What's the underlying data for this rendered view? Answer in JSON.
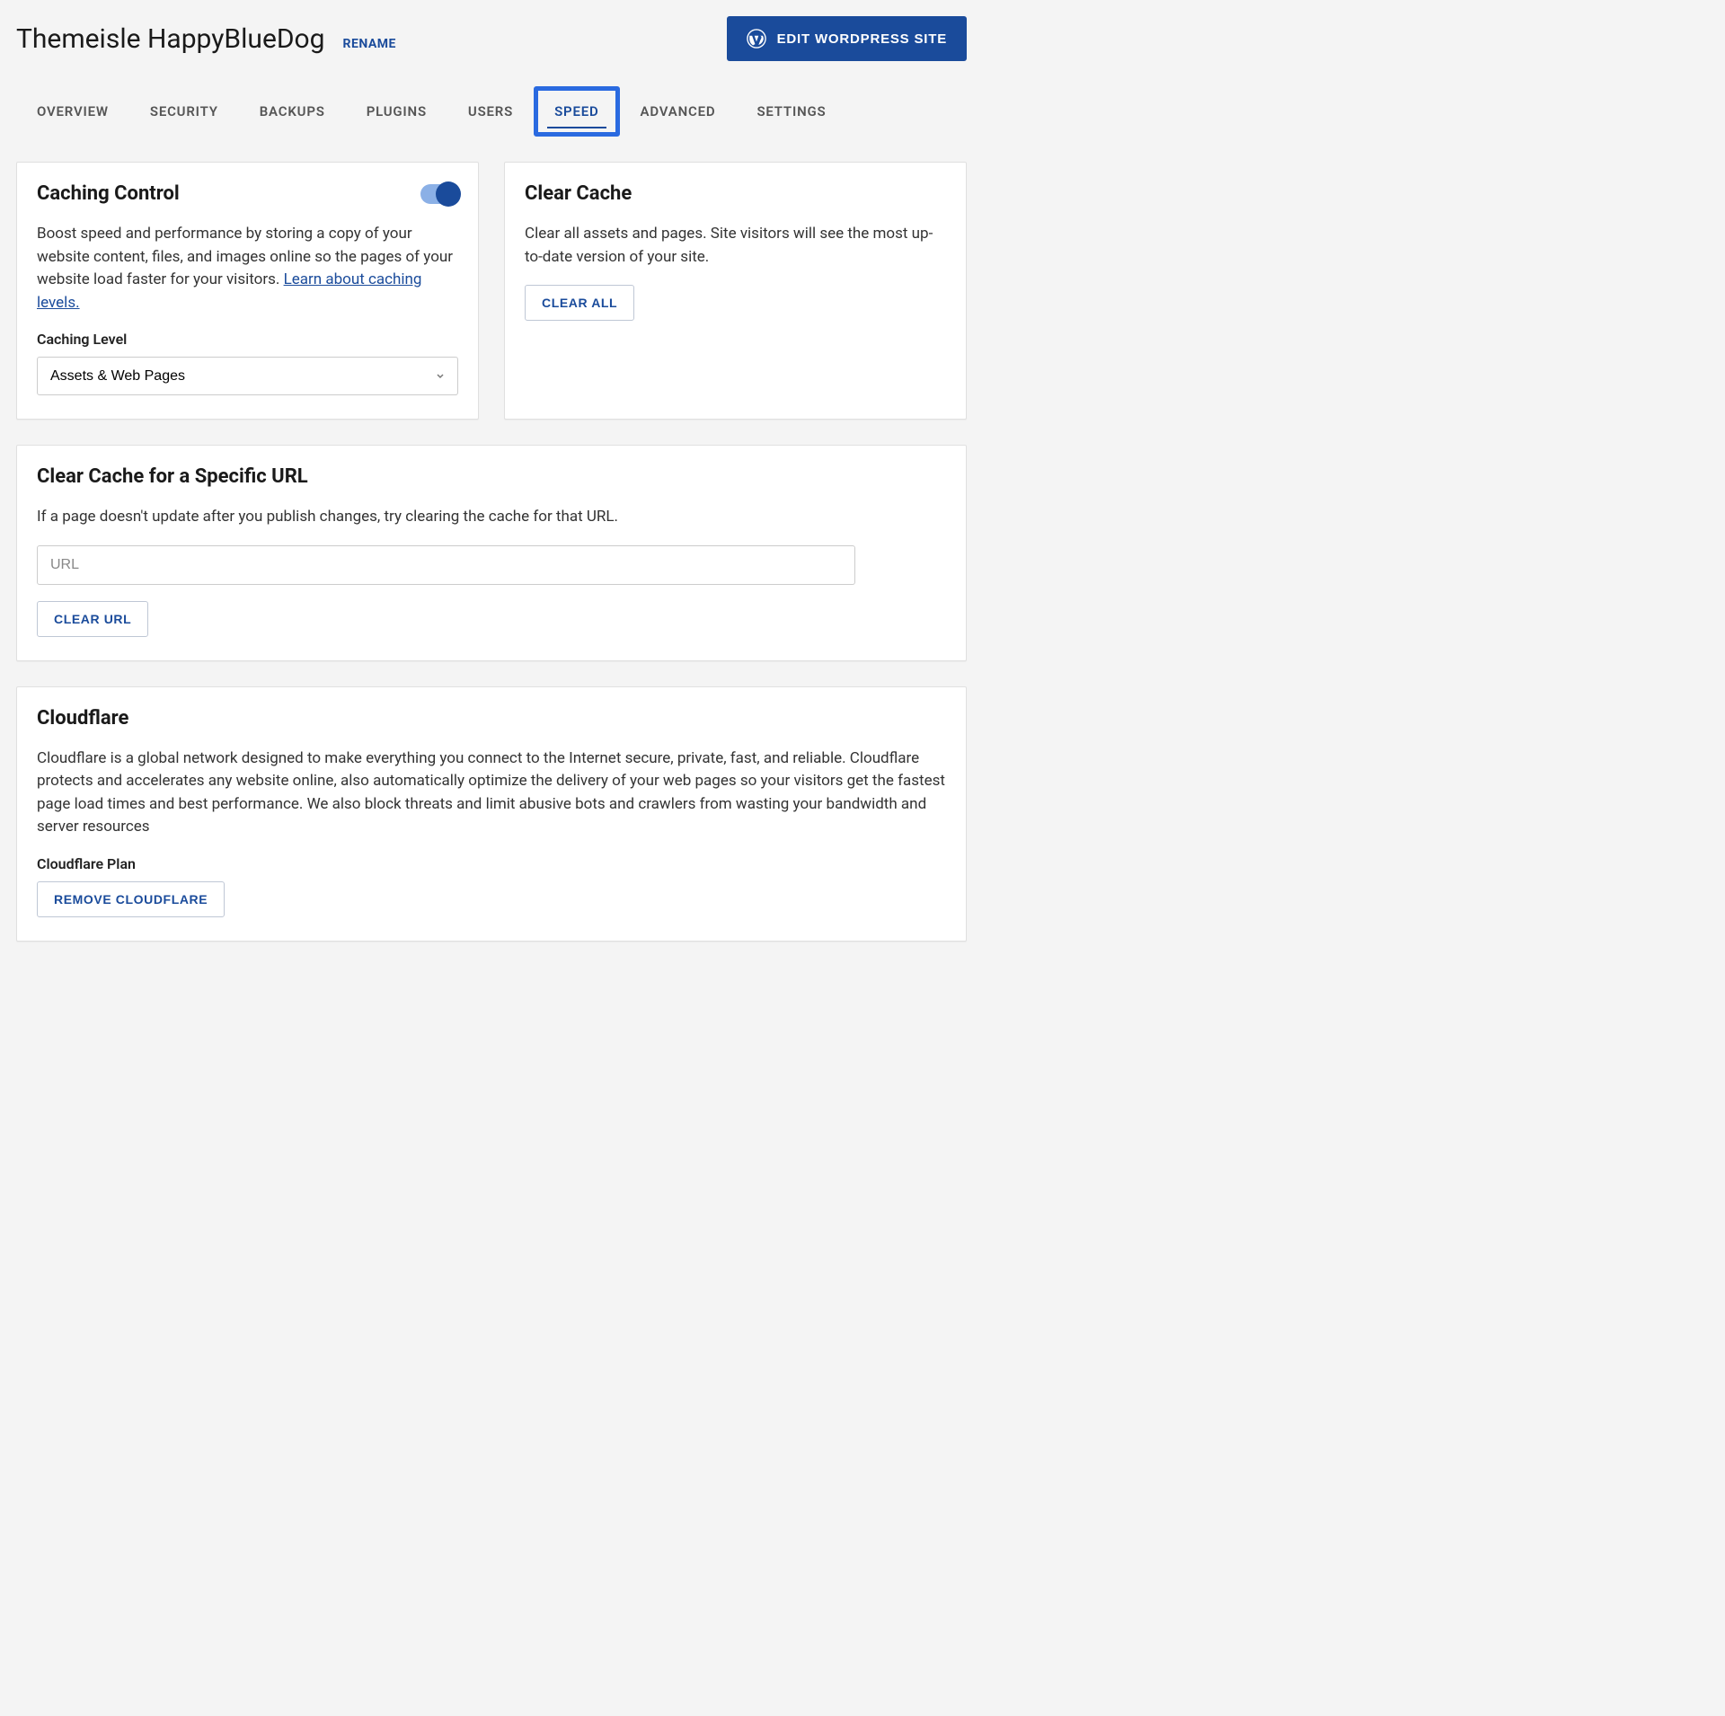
{
  "header": {
    "site_title": "Themeisle HappyBlueDog",
    "rename_label": "RENAME",
    "edit_wp_label": "EDIT WORDPRESS SITE"
  },
  "tabs": {
    "items": [
      {
        "label": "OVERVIEW"
      },
      {
        "label": "SECURITY"
      },
      {
        "label": "BACKUPS"
      },
      {
        "label": "PLUGINS"
      },
      {
        "label": "USERS"
      },
      {
        "label": "SPEED",
        "active": true
      },
      {
        "label": "ADVANCED"
      },
      {
        "label": "SETTINGS"
      }
    ]
  },
  "caching_control": {
    "title": "Caching Control",
    "toggle_on": true,
    "desc_prefix": "Boost speed and performance by storing a copy of your website content, files, and images online so the pages of your website load faster for your visitors. ",
    "learn_link": "Learn about caching levels.",
    "level_label": "Caching Level",
    "level_value": "Assets & Web Pages"
  },
  "clear_cache": {
    "title": "Clear Cache",
    "desc": "Clear all assets and pages. Site visitors will see the most up-to-date version of your site.",
    "button": "CLEAR ALL"
  },
  "clear_url": {
    "title": "Clear Cache for a Specific URL",
    "desc": "If a page doesn't update after you publish changes, try clearing the cache for that URL.",
    "placeholder": "URL",
    "button": "CLEAR URL"
  },
  "cloudflare": {
    "title": "Cloudflare",
    "desc": "Cloudflare is a global network designed to make everything you connect to the Internet secure, private, fast, and reliable. Cloudflare protects and accelerates any website online, also automatically optimize the delivery of your web pages so your visitors get the fastest page load times and best performance. We also block threats and limit abusive bots and crawlers from wasting your bandwidth and server resources",
    "plan_label": "Cloudflare Plan",
    "button": "REMOVE CLOUDFLARE"
  }
}
